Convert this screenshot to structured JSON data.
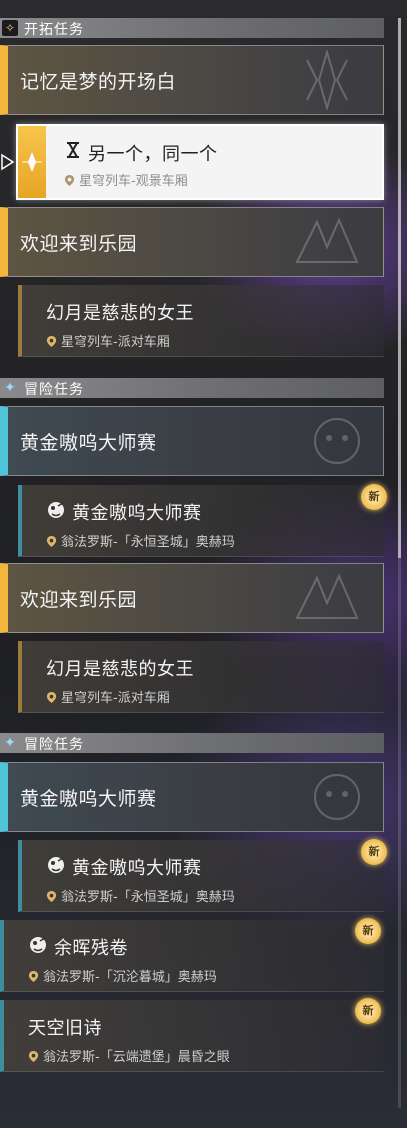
{
  "sections": {
    "trailblaze": {
      "label": "开拓任务",
      "icon": "trailblaze-icon"
    },
    "adventure_1": {
      "label": "冒险任务",
      "icon": "adventure-icon"
    },
    "adventure_2": {
      "label": "冒险任务",
      "icon": "adventure-icon"
    }
  },
  "quests": {
    "memory": {
      "title": "记忆是梦的开场白"
    },
    "selected": {
      "title": "另一个，同一个",
      "location": "星穹列车-观景车厢",
      "icon": "hourglass-icon"
    },
    "welcome_1": {
      "title": "欢迎来到乐园"
    },
    "illusion_1": {
      "title": "幻月是慈悲的女王",
      "location": "星穹列车-派对车厢"
    },
    "golden_1": {
      "title": "黄金嗷呜大师赛"
    },
    "golden_sub_1": {
      "title": "黄金嗷呜大师赛",
      "location": "翁法罗斯-「永恒圣城」奥赫玛",
      "badge": "新"
    },
    "welcome_2": {
      "title": "欢迎来到乐园"
    },
    "illusion_2": {
      "title": "幻月是慈悲的女王",
      "location": "星穹列车-派对车厢"
    },
    "golden_2": {
      "title": "黄金嗷呜大师赛"
    },
    "golden_sub_2": {
      "title": "黄金嗷呜大师赛",
      "location": "翁法罗斯-「永恒圣城」奥赫玛",
      "badge": "新"
    },
    "afterglow": {
      "title": "余晖残卷",
      "location": "翁法罗斯-「沉沦暮城」奥赫玛",
      "badge": "新"
    },
    "sky_poem": {
      "title": "天空旧诗",
      "location": "翁法罗斯-「云端遗堡」晨昏之眼",
      "badge": "新"
    }
  },
  "colors": {
    "gold_accent": "#f3b63c",
    "blue_accent": "#4fc3d7",
    "selected_bg": "#f4f4f4"
  }
}
